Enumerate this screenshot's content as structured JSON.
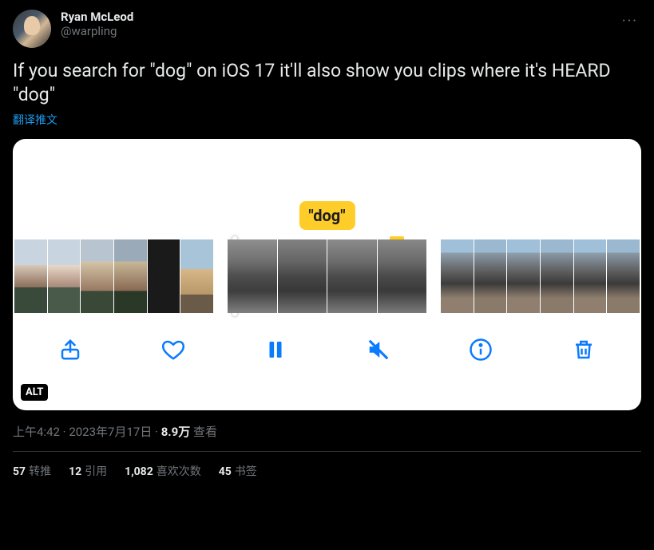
{
  "author": {
    "display_name": "Ryan McLeod",
    "handle": "@warpling"
  },
  "more_label": "···",
  "body_text": "If you search for \"dog\" on iOS 17 it'll also show you clips where it's HEARD \"dog\"",
  "translate_label": "翻译推文",
  "media": {
    "caption_bubble": "\"dog\"",
    "alt_badge": "ALT",
    "toolbar": {
      "share": "share",
      "like": "like",
      "pause": "pause",
      "mute": "mute",
      "info": "info",
      "delete": "delete"
    }
  },
  "meta": {
    "time": "上午4:42",
    "date": "2023年7月17日",
    "views_count": "8.9万",
    "views_label": "查看",
    "sep": " · "
  },
  "stats": {
    "retweets": {
      "count": "57",
      "label": "转推"
    },
    "quotes": {
      "count": "12",
      "label": "引用"
    },
    "likes": {
      "count": "1,082",
      "label": "喜欢次数"
    },
    "bookmarks": {
      "count": "45",
      "label": "书签"
    }
  }
}
